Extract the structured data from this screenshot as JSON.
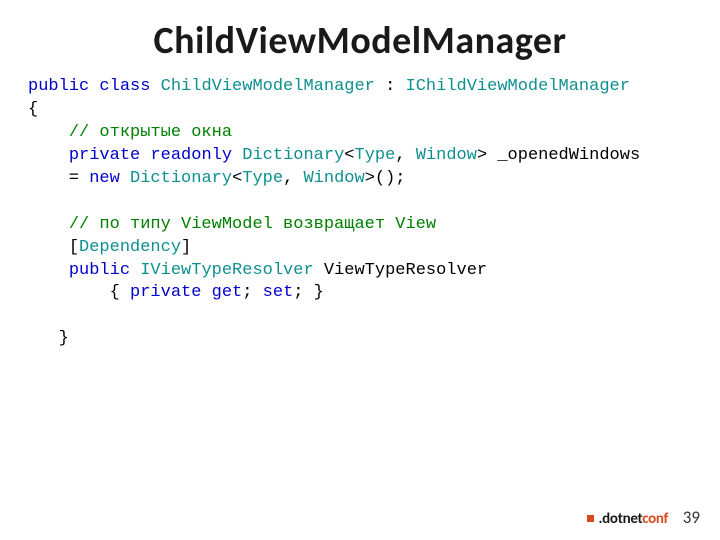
{
  "title": "ChildViewModelManager",
  "code": {
    "kw_public1": "public",
    "kw_class": "class",
    "cls_name": "ChildViewModelManager",
    "colon_space": " : ",
    "cls_iface": "IChildViewModelManager",
    "brace_open": "{",
    "cmt1": "// открытые окна",
    "kw_private1": "private",
    "kw_readonly": "readonly",
    "cls_dict1": "Dictionary",
    "lt1": "<",
    "cls_type1": "Type",
    "comma1": ", ",
    "cls_window1": "Window",
    "gt1": "> ",
    "field1": "_openedWindows",
    "eq_prefix": "    = ",
    "kw_new": "new",
    "cls_dict2": "Dictionary",
    "lt2": "<",
    "cls_type2": "Type",
    "comma2": ", ",
    "cls_window2": "Window",
    "gt2": ">();",
    "cmt2": "// по типу ViewModel возвращает View",
    "br_open": "[",
    "cls_dep": "Dependency",
    "br_close": "]",
    "kw_public2": "public",
    "cls_resolver": "IViewTypeResolver",
    "prop_name": " ViewTypeResolver",
    "prop_open": "        { ",
    "kw_private2": "private",
    "kw_get": "get",
    "semi1": "; ",
    "kw_set": "set",
    "semi2": "; }",
    "brace_close": "   }"
  },
  "page_number": "39",
  "logo": {
    "dot": ".dotnet",
    "conf": "conf"
  }
}
